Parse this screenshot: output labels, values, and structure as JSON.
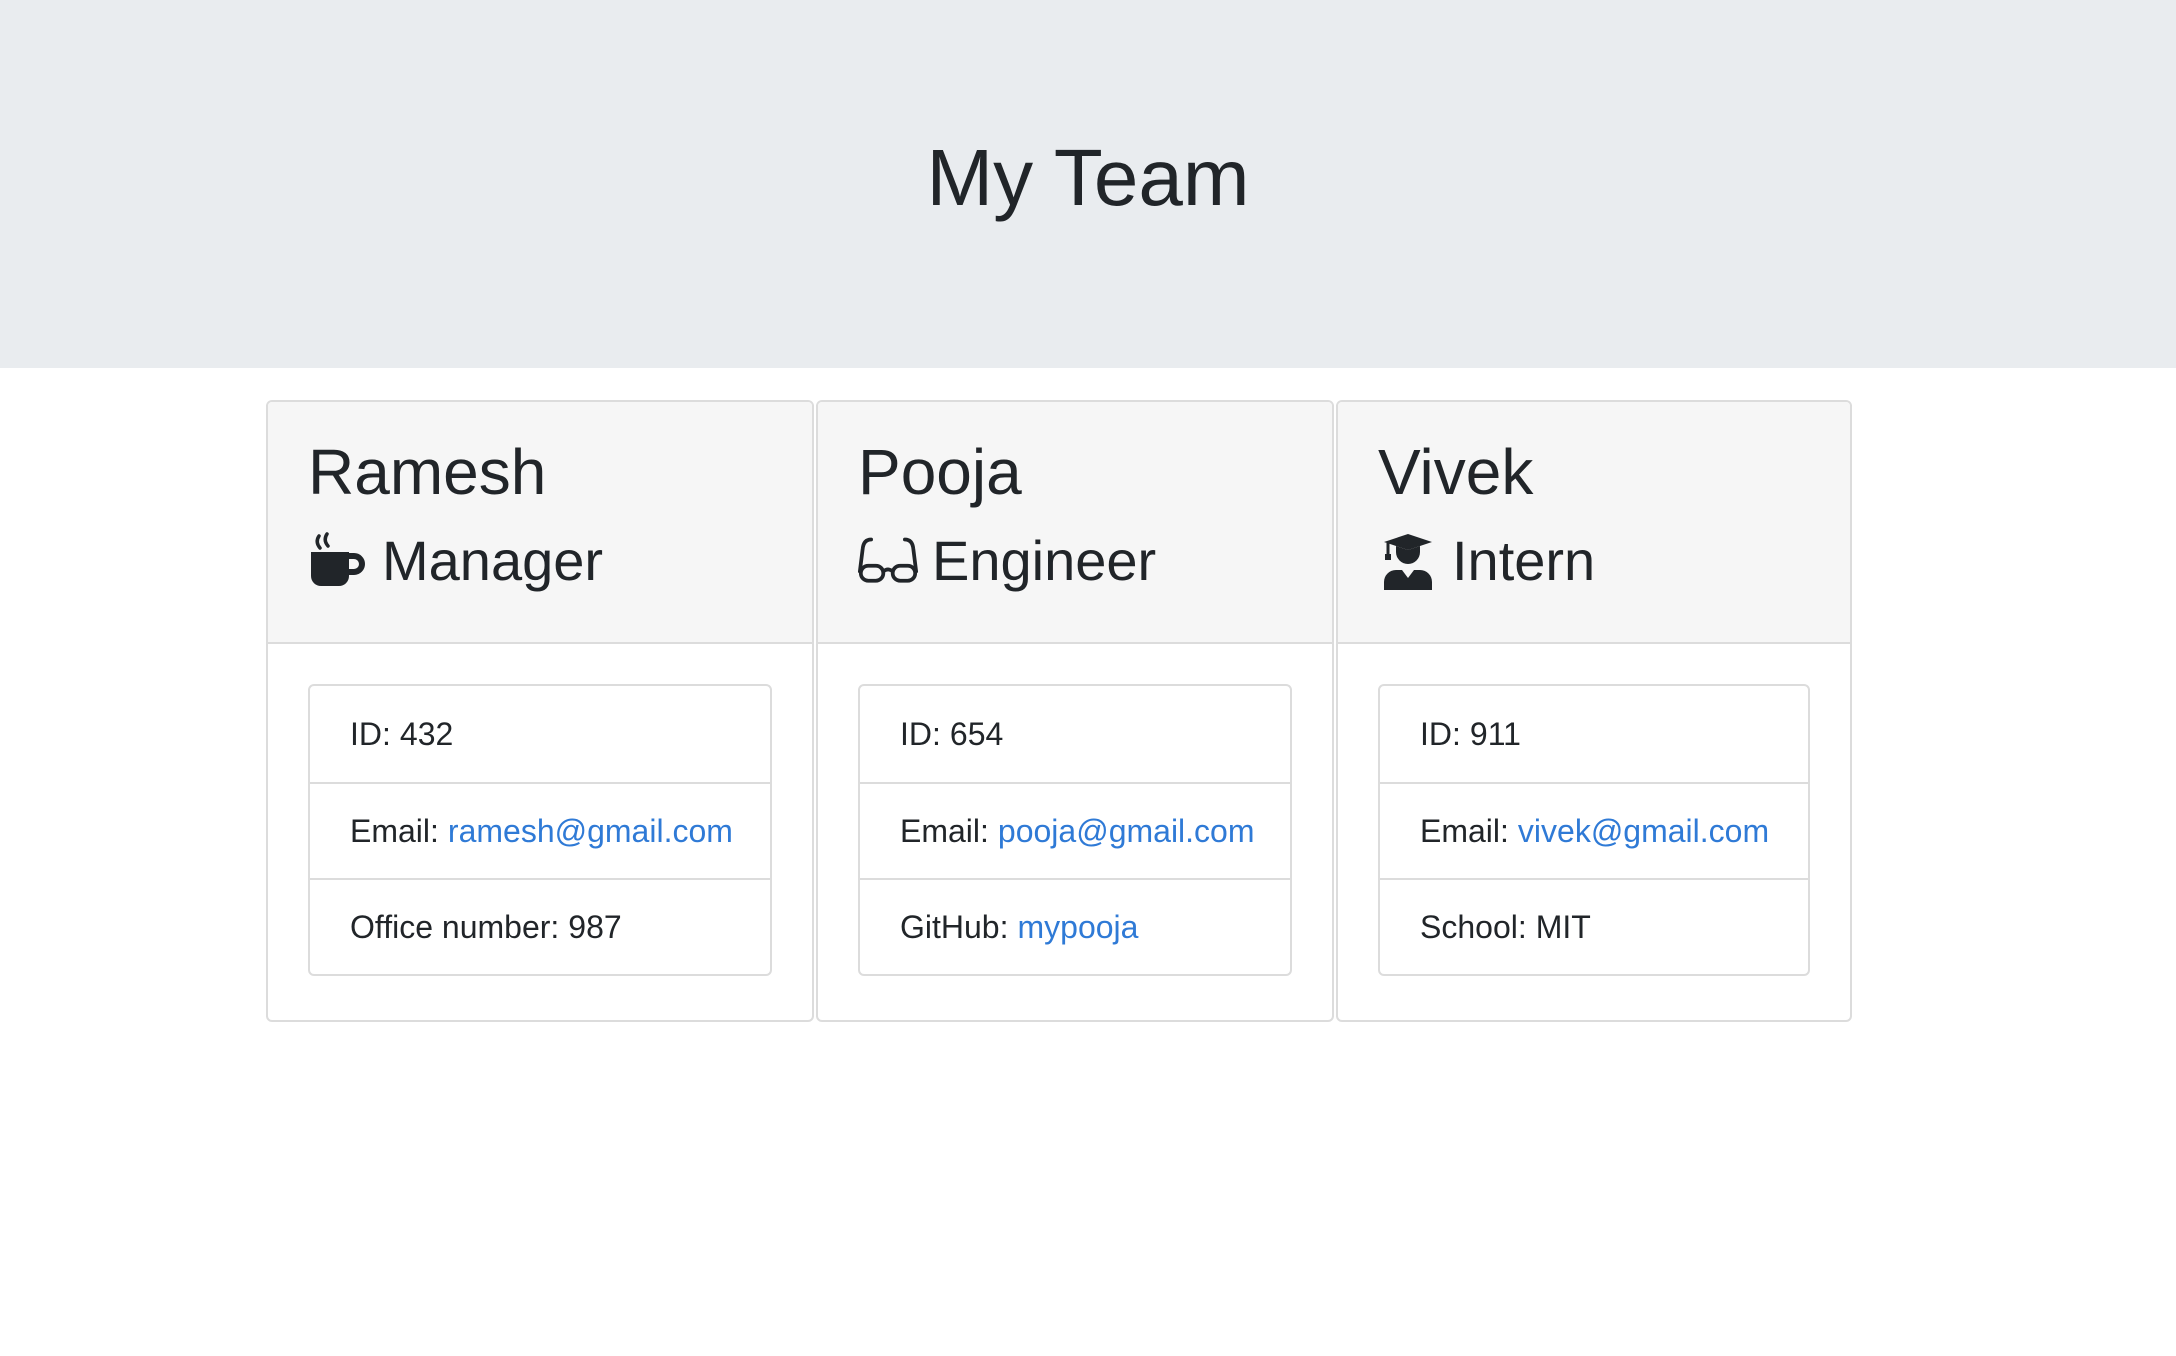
{
  "header": {
    "title": "My Team"
  },
  "colors": {
    "jumbotron_bg": "#e9ecef",
    "card_header_bg": "#f6f6f6",
    "link": "#2f7ad6",
    "text": "#212529"
  },
  "employees": [
    {
      "name": "Ramesh",
      "role": "Manager",
      "icon": "coffee-mug-icon",
      "id_label": "ID:",
      "id": "432",
      "email_label": "Email:",
      "email": "ramesh@gmail.com",
      "extra_label": "Office number:",
      "extra_value": "987"
    },
    {
      "name": "Pooja",
      "role": "Engineer",
      "icon": "glasses-icon",
      "id_label": "ID:",
      "id": "654",
      "email_label": "Email:",
      "email": "pooja@gmail.com",
      "extra_label": "GitHub:",
      "extra_value": "mypooja"
    },
    {
      "name": "Vivek",
      "role": "Intern",
      "icon": "graduate-icon",
      "id_label": "ID:",
      "id": "911",
      "email_label": "Email:",
      "email": "vivek@gmail.com",
      "extra_label": "School:",
      "extra_value": "MIT"
    }
  ]
}
